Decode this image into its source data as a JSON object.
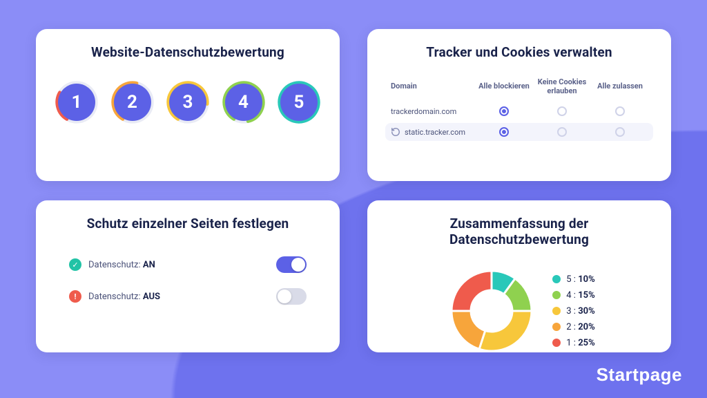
{
  "colors": {
    "accent": "#5c61e6",
    "red": "#ef5b4c",
    "orange": "#f7a53b",
    "yellow": "#f7c73b",
    "green": "#8fd14f",
    "teal": "#29c8b9"
  },
  "footer": {
    "brand": "Startpage"
  },
  "card_rating": {
    "title": "Website-Datenschutzbewertung",
    "badges": [
      {
        "n": "1",
        "ring": "#ef5b4c",
        "pct": 25
      },
      {
        "n": "2",
        "ring": "#f7a53b",
        "pct": 45
      },
      {
        "n": "3",
        "ring": "#f7c73b",
        "pct": 68
      },
      {
        "n": "4",
        "ring": "#8fd14f",
        "pct": 88
      },
      {
        "n": "5",
        "ring": "#29c8b9",
        "pct": 100
      }
    ]
  },
  "card_tracker": {
    "title": "Tracker und Cookies verwalten",
    "headers": {
      "domain": "Domain",
      "block": "Alle blockieren",
      "nocookies": "Keine Cookies erlauben",
      "allow": "Alle zulassen"
    },
    "rows": [
      {
        "domain": "trackerdomain.com",
        "selected": 0,
        "reload": false
      },
      {
        "domain": "static.tracker.com",
        "selected": 0,
        "reload": true
      }
    ]
  },
  "card_protect": {
    "title": "Schutz einzelner Seiten festlegen",
    "rows": [
      {
        "label": "Datenschutz:",
        "state_label": "AN",
        "on": true
      },
      {
        "label": "Datenschutz:",
        "state_label": "AUS",
        "on": false
      }
    ]
  },
  "card_summary": {
    "title": "Zusammenfassung der Datenschutzbewertung",
    "legend": [
      {
        "score": "5",
        "pct": "10%",
        "color": "#29c8b9"
      },
      {
        "score": "4",
        "pct": "15%",
        "color": "#8fd14f"
      },
      {
        "score": "3",
        "pct": "30%",
        "color": "#f7c73b"
      },
      {
        "score": "2",
        "pct": "20%",
        "color": "#f7a53b"
      },
      {
        "score": "1",
        "pct": "25%",
        "color": "#ef5b4c"
      }
    ]
  },
  "chart_data": {
    "type": "pie",
    "title": "Zusammenfassung der Datenschutzbewertung",
    "categories": [
      "5",
      "4",
      "3",
      "2",
      "1"
    ],
    "values": [
      10,
      15,
      30,
      20,
      25
    ],
    "colors": [
      "#29c8b9",
      "#8fd14f",
      "#f7c73b",
      "#f7a53b",
      "#ef5b4c"
    ],
    "donut": true
  }
}
